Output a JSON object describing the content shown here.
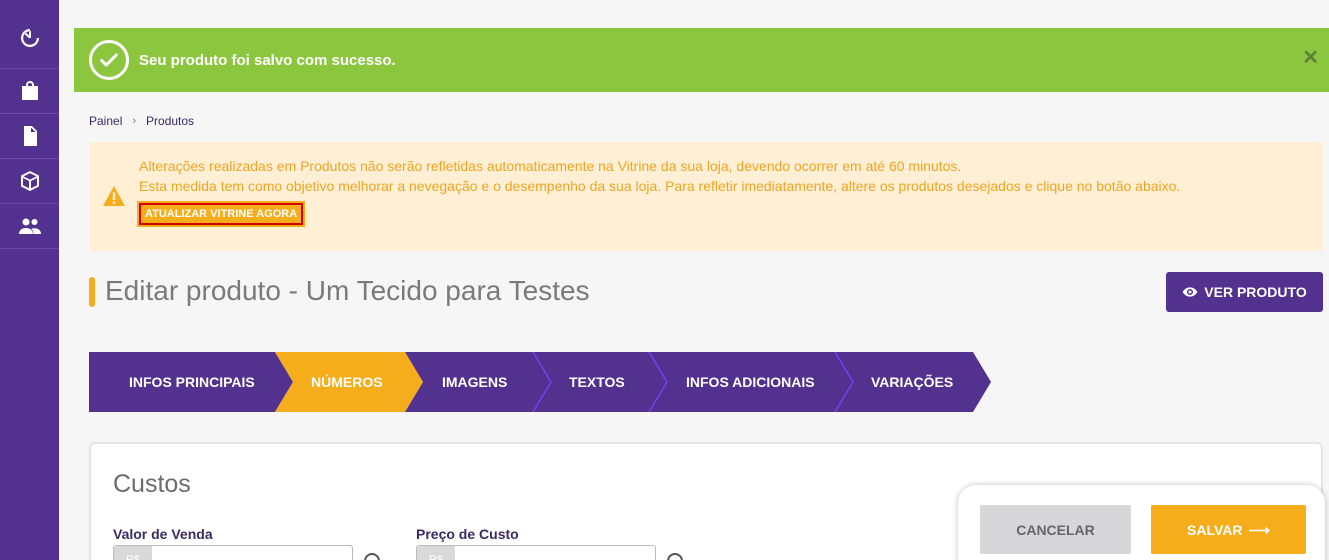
{
  "sidebar": {
    "items": [
      {
        "icon": "timer-icon"
      },
      {
        "icon": "shopping-bag-icon"
      },
      {
        "icon": "document-icon"
      },
      {
        "icon": "box-icon"
      },
      {
        "icon": "users-icon"
      }
    ],
    "color": "#53318f"
  },
  "toast": {
    "message": "Seu produto foi salvo com sucesso.",
    "close": "✕",
    "color": "#8cc63f"
  },
  "breadcrumb": {
    "items": [
      "Painel",
      "Produtos"
    ],
    "separator": "›"
  },
  "warning": {
    "line1": "Alterações realizadas em Produtos não serão refletidas automaticamente na Vitrine da sua loja, devendo ocorrer em até 60 minutos.",
    "line2": "Esta medida tem como objetivo melhorar a nevegação e o desempenho da sua loja. Para refletir imediatamente, altere os produtos desejados e clique no botão abaixo.",
    "button": "ATUALIZAR VITRINE AGORA",
    "color": "#f0a420"
  },
  "page": {
    "title": "Editar produto - Um Tecido para Testes",
    "view_button": "VER PRODUTO"
  },
  "tabs": [
    {
      "label": "INFOS PRINCIPAIS",
      "active": false
    },
    {
      "label": "NÚMEROS",
      "active": true
    },
    {
      "label": "IMAGENS",
      "active": false
    },
    {
      "label": "TEXTOS",
      "active": false
    },
    {
      "label": "INFOS ADICIONAIS",
      "active": false
    },
    {
      "label": "VARIAÇÕES",
      "active": false
    }
  ],
  "costs": {
    "title": "Custos",
    "fields": [
      {
        "label": "Valor de Venda",
        "addon": "R$",
        "value": ""
      },
      {
        "label": "Preço de Custo",
        "addon": "R$",
        "value": ""
      }
    ]
  },
  "actions": {
    "cancel": "CANCELAR",
    "save": "SALVAR",
    "save_arrow": "⟶"
  },
  "colors": {
    "primary": "#53318f",
    "accent": "#f6ad1c",
    "success": "#8cc63f"
  }
}
